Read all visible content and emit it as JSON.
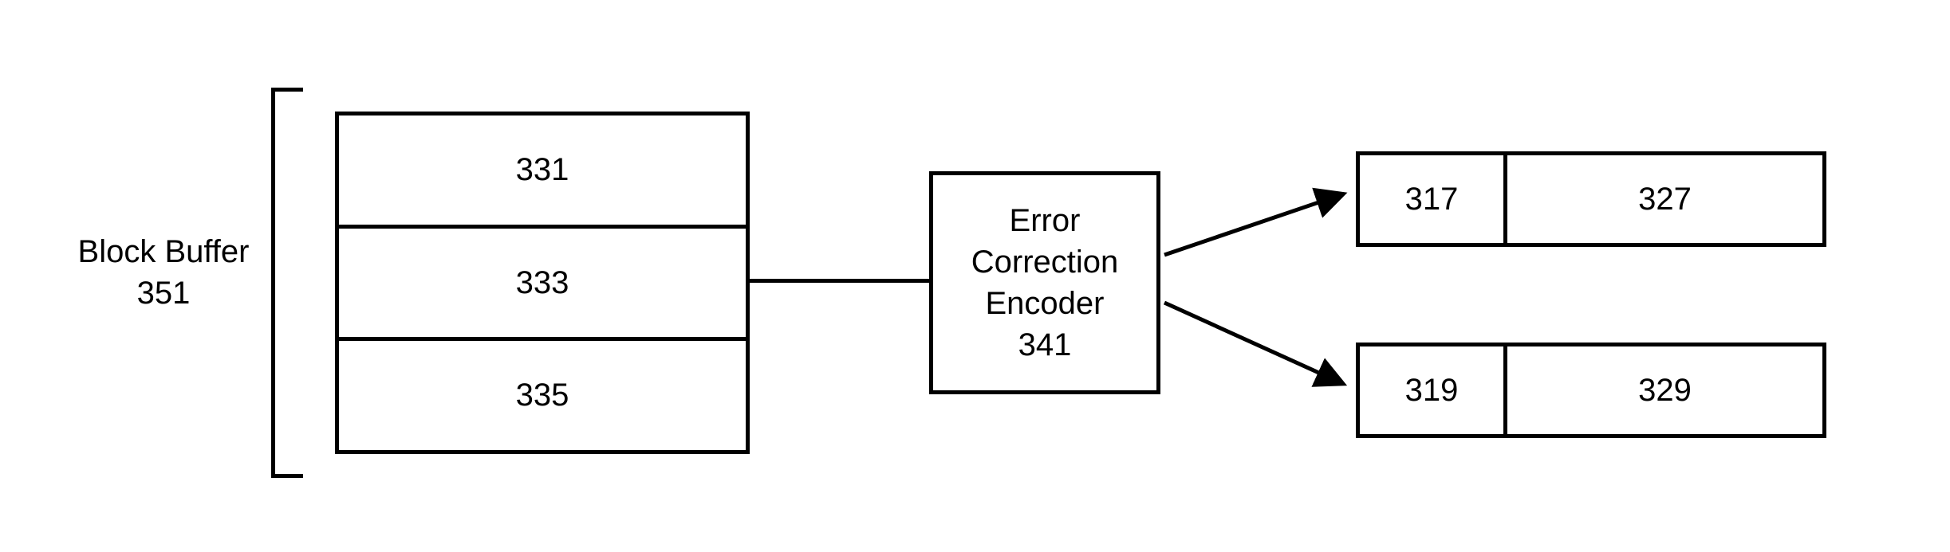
{
  "block_buffer": {
    "label_line1": "Block Buffer",
    "label_line2": "351",
    "rows": [
      "331",
      "333",
      "335"
    ]
  },
  "encoder": {
    "line1": "Error",
    "line2": "Correction",
    "line3": "Encoder",
    "line4": "341"
  },
  "output_top": {
    "left": "317",
    "right": "327"
  },
  "output_bottom": {
    "left": "319",
    "right": "329"
  }
}
